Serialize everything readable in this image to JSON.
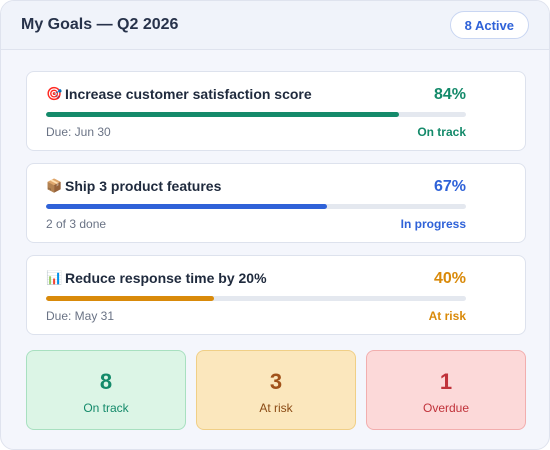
{
  "header": {
    "title": "My Goals — Q2 2026",
    "badge": "8 Active"
  },
  "goals": [
    {
      "icon": "🎯",
      "icon_name": "target-icon",
      "title": "Increase customer satisfaction score",
      "percent_label": "84%",
      "progress": 0.84,
      "meta": "Due: Jun 30",
      "status": "On track",
      "color": "#148a6a"
    },
    {
      "icon": "📦",
      "icon_name": "package-icon",
      "title": "Ship 3 product features",
      "percent_label": "67%",
      "progress": 0.67,
      "meta": "2 of 3 done",
      "status": "In progress",
      "color": "#2f62d8"
    },
    {
      "icon": "📊",
      "icon_name": "bar-chart-icon",
      "title": "Reduce response time by 20%",
      "percent_label": "40%",
      "progress": 0.4,
      "meta": "Due: May 31",
      "status": "At risk",
      "color": "#d98a0a"
    }
  ],
  "stats": [
    {
      "value": "8",
      "label": "On track",
      "bg": "#dcf5e6",
      "border": "#a8e0c0",
      "num_color": "#148a6a",
      "label_color": "#148a6a"
    },
    {
      "value": "3",
      "label": "At risk",
      "bg": "#fbe7bd",
      "border": "#f0cf86",
      "num_color": "#a1521a",
      "label_color": "#8a4a14"
    },
    {
      "value": "1",
      "label": "Overdue",
      "bg": "#fcd9d9",
      "border": "#f2aeae",
      "num_color": "#c0323a",
      "label_color": "#c0323a"
    }
  ]
}
